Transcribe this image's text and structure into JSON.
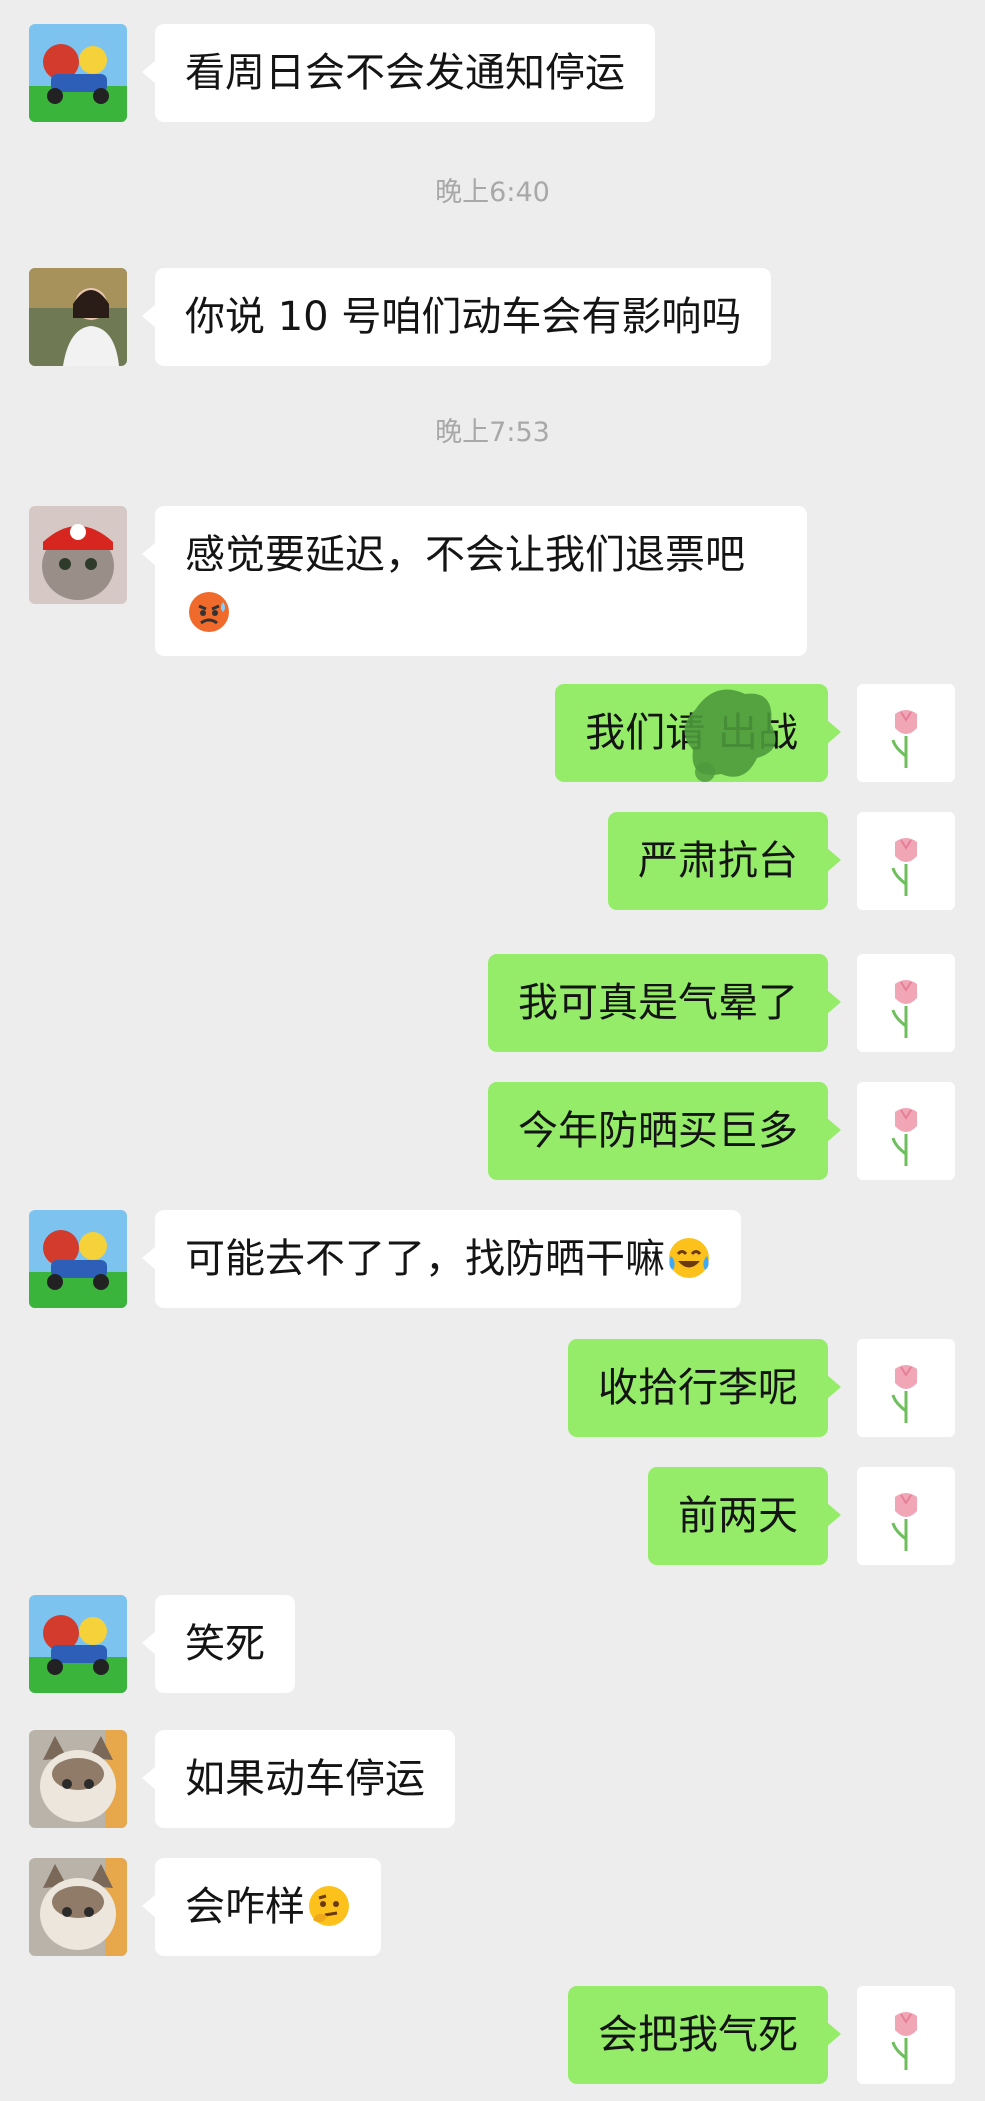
{
  "messages": [
    {
      "side": "in",
      "avatar": "mario-kart-avatar",
      "text": "看周日会不会发通知停运"
    },
    {
      "time": "晚上6:40"
    },
    {
      "side": "in",
      "avatar": "girl-photo-avatar",
      "text": "你说 10 号咱们动车会有影响吗"
    },
    {
      "time": "晚上7:53"
    },
    {
      "side": "in",
      "avatar": "cat-mario-hat-avatar",
      "text": "感觉要延迟，不会让我们退票吧",
      "emoji": "angry-sweat-emoji"
    },
    {
      "side": "out",
      "avatar": "tulip-avatar",
      "text": "我们请       出战",
      "redacted": true
    },
    {
      "side": "out",
      "avatar": "tulip-avatar",
      "text": "严肃抗台"
    },
    {
      "side": "out",
      "avatar": "tulip-avatar",
      "text": "我可真是气晕了"
    },
    {
      "side": "out",
      "avatar": "tulip-avatar",
      "text": "今年防晒买巨多"
    },
    {
      "side": "in",
      "avatar": "mario-kart-avatar",
      "text": "可能去不了了，找防晒干嘛",
      "emoji": "crying-laughing-emoji"
    },
    {
      "side": "out",
      "avatar": "tulip-avatar",
      "text": "收拾行李呢"
    },
    {
      "side": "out",
      "avatar": "tulip-avatar",
      "text": "前两天"
    },
    {
      "side": "in",
      "avatar": "mario-kart-avatar",
      "text": "笑死"
    },
    {
      "side": "in",
      "avatar": "ragdoll-cat-avatar",
      "text": "如果动车停运"
    },
    {
      "side": "in",
      "avatar": "ragdoll-cat-avatar",
      "text": "会咋样",
      "emoji": "thinking-face-emoji"
    },
    {
      "side": "out",
      "avatar": "tulip-avatar",
      "text": "会把我气死"
    }
  ],
  "colors": {
    "background": "#ededed",
    "incoming_bubble": "#ffffff",
    "outgoing_bubble": "#95ec69",
    "timestamp": "#a8a8a8"
  }
}
